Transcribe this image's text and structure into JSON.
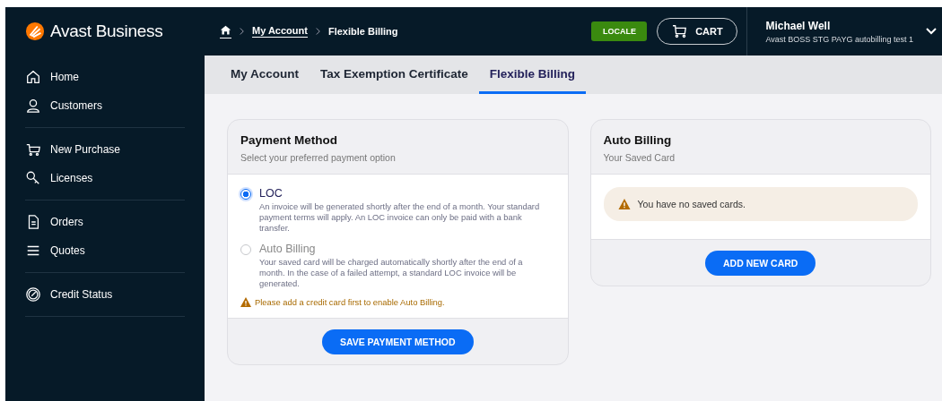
{
  "brand": {
    "name": "Avast Business"
  },
  "breadcrumb": [
    {
      "label": "My Account",
      "link": true
    },
    {
      "label": "Flexible Billing",
      "link": false
    }
  ],
  "header": {
    "locale_button": "LOCALE",
    "cart_button": "CART",
    "user": {
      "name": "Michael Well",
      "account": "Avast BOSS STG PAYG autobilling test 1"
    }
  },
  "sidebar": {
    "groups": [
      {
        "items": [
          {
            "label": "Home",
            "kind": "home"
          },
          {
            "label": "Customers",
            "kind": "person"
          }
        ]
      },
      {
        "items": [
          {
            "label": "New Purchase",
            "kind": "cart"
          },
          {
            "label": "Licenses",
            "kind": "key"
          }
        ]
      },
      {
        "items": [
          {
            "label": "Orders",
            "kind": "document"
          },
          {
            "label": "Quotes",
            "kind": "list"
          }
        ]
      },
      {
        "items": [
          {
            "label": "Credit Status",
            "kind": "gauge"
          }
        ]
      }
    ]
  },
  "tabs": [
    {
      "label": "My Account",
      "selected": false
    },
    {
      "label": "Tax Exemption Certificate",
      "selected": false
    },
    {
      "label": "Flexible Billing",
      "selected": true
    }
  ],
  "payment_method": {
    "title": "Payment Method",
    "subtitle": "Select your preferred payment option",
    "options": [
      {
        "label": "LOC",
        "selected": true,
        "disabled": false,
        "description": "An invoice will be generated shortly after the end of a month. Your standard payment terms will apply. An LOC invoice can only be paid with a bank transfer."
      },
      {
        "label": "Auto Billing",
        "selected": false,
        "disabled": true,
        "description": "Your saved card will be charged automatically shortly after the end of a month. In the case of a failed attempt, a standard LOC invoice will be generated."
      }
    ],
    "warning": "Please add a credit card first to enable Auto Billing.",
    "button": "SAVE PAYMENT METHOD"
  },
  "auto_billing": {
    "title": "Auto Billing",
    "subtitle": "Your Saved Card",
    "notice": "You have no saved cards.",
    "button": "ADD NEW CARD"
  }
}
